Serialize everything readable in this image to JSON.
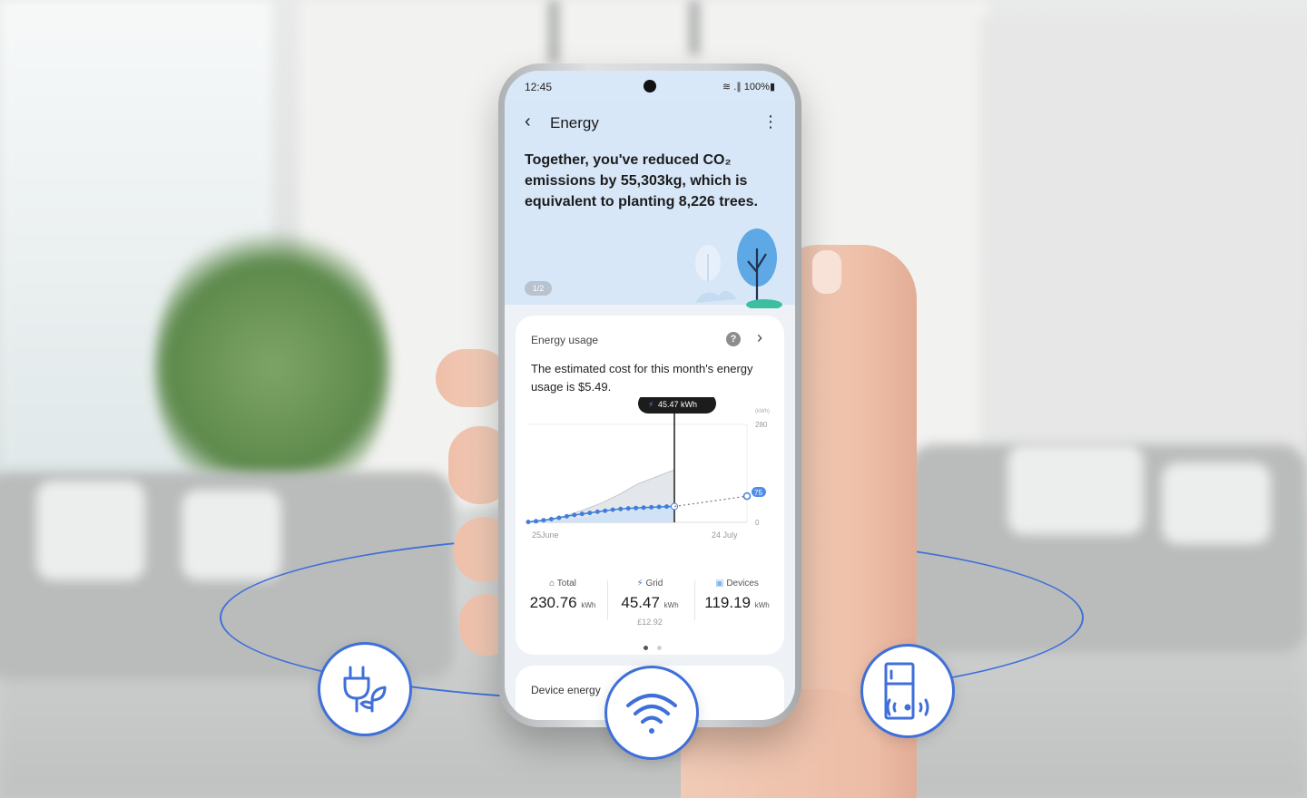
{
  "status_bar": {
    "time": "12:45",
    "indicators": "≋ .∥ 100%▮"
  },
  "app_bar": {
    "title": "Energy",
    "back_icon": "chevron-left-icon",
    "more_icon": "more-vert-icon"
  },
  "hero": {
    "message": "Together, you've reduced CO₂ emissions by 55,303kg, which is equivalent to planting 8,226 trees.",
    "page_indicator": "1/2"
  },
  "energy_card": {
    "title": "Energy usage",
    "description": "The estimated cost for this month's energy usage is $5.49.",
    "tooltip": "45.47 kWh",
    "y_unit": "(kWh)",
    "y_max_label": "280",
    "y_min_label": "0",
    "forecast_label": "75",
    "x_start_label": "25June",
    "x_end_label": "24 July",
    "stats": [
      {
        "icon": "home-icon",
        "label": "Total",
        "value": "230.76",
        "unit": "kWh",
        "sub": ""
      },
      {
        "icon": "bolt-icon",
        "label": "Grid",
        "value": "45.47",
        "unit": "kWh",
        "sub": "£12.92"
      },
      {
        "icon": "devices-icon",
        "label": "Devices",
        "value": "119.19",
        "unit": "kWh",
        "sub": ""
      }
    ]
  },
  "device_card": {
    "title": "Device energy"
  },
  "accent_color": "#3f6fd8",
  "feature_icons": [
    "plug-leaf-icon",
    "wifi-icon",
    "fridge-wireless-icon"
  ],
  "chart_data": {
    "type": "area",
    "x_range": [
      "25June",
      "24 July"
    ],
    "ylim": [
      0,
      280
    ],
    "selected_value": 45.47,
    "forecast_value": 75,
    "series": [
      {
        "values": [
          2,
          8,
          18,
          35,
          55,
          80,
          110,
          130,
          150
        ]
      },
      {
        "values": [
          1,
          4,
          8,
          14,
          22,
          30,
          38,
          45,
          50
        ]
      },
      {
        "values": [
          1,
          3,
          6,
          9,
          13,
          17,
          21,
          24,
          27,
          30,
          33,
          36,
          38,
          40,
          41,
          42,
          43,
          44,
          45,
          45.47
        ]
      }
    ],
    "forecast": [
      45.47,
      75
    ]
  }
}
